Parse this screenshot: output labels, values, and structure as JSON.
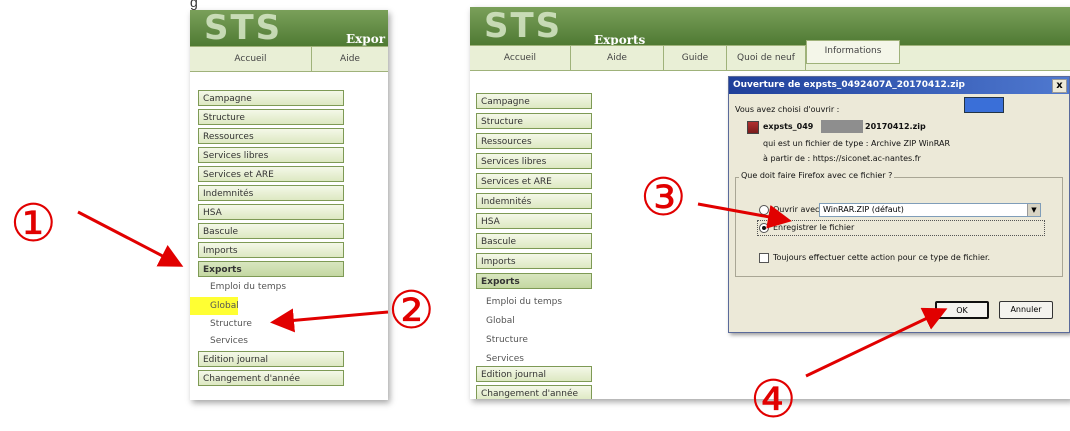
{
  "caption": "g",
  "left_panel": {
    "logo": "STS",
    "section_title": "Expor",
    "tabs": [
      "Accueil",
      "Aide"
    ],
    "menu": [
      "Campagne",
      "Structure",
      "Ressources",
      "Services libres",
      "Services et ARE",
      "Indemnités",
      "HSA",
      "Bascule",
      "Imports",
      "Exports"
    ],
    "active_menu": "Exports",
    "submenu": [
      "Emploi du temps",
      "Global",
      "Structure",
      "Services"
    ],
    "highlighted_submenu": "Global",
    "menu_bottom": [
      "Edition journal",
      "Changement d'année"
    ]
  },
  "right_panel": {
    "logo": "STS",
    "section_title": "Exports",
    "tabs": [
      "Accueil",
      "Aide",
      "Guide",
      "Quoi de neuf",
      "Informations"
    ],
    "menu": [
      "Campagne",
      "Structure",
      "Ressources",
      "Services libres",
      "Services et ARE",
      "Indemnités",
      "HSA",
      "Bascule",
      "Imports",
      "Exports"
    ],
    "active_menu": "Exports",
    "submenu": [
      "Emploi du temps",
      "Global",
      "Structure",
      "Services"
    ],
    "menu_bottom": [
      "Edition journal",
      "Changement d'année"
    ]
  },
  "dialog": {
    "title": "Ouverture de expsts_0492407A_20170412.zip",
    "close": "x",
    "intro": "Vous avez choisi d'ouvrir :",
    "filename_start": "expsts_049",
    "filename_end": "20170412.zip",
    "type_line": "qui est un fichier de type : Archive ZIP WinRAR",
    "from_line": "à partir de : https://siconet.ac-nantes.fr",
    "group_title": "Que doit faire Firefox avec ce fichier ?",
    "open_with_label": "Ouvrir avec",
    "open_with_value": "WinRAR.ZIP (défaut)",
    "save_label": "Enregistrer le fichier",
    "save_selected": true,
    "always_label": "Toujours effectuer cette action pour ce type de fichier.",
    "ok_button": "OK",
    "cancel_button": "Annuler"
  },
  "annotations": [
    "①",
    "②",
    "③",
    "④"
  ],
  "colors": {
    "annotation": "#e10000",
    "highlight": "#ffff33",
    "menu_border": "#7e9a55",
    "title_bar": "#1f3f9a"
  }
}
